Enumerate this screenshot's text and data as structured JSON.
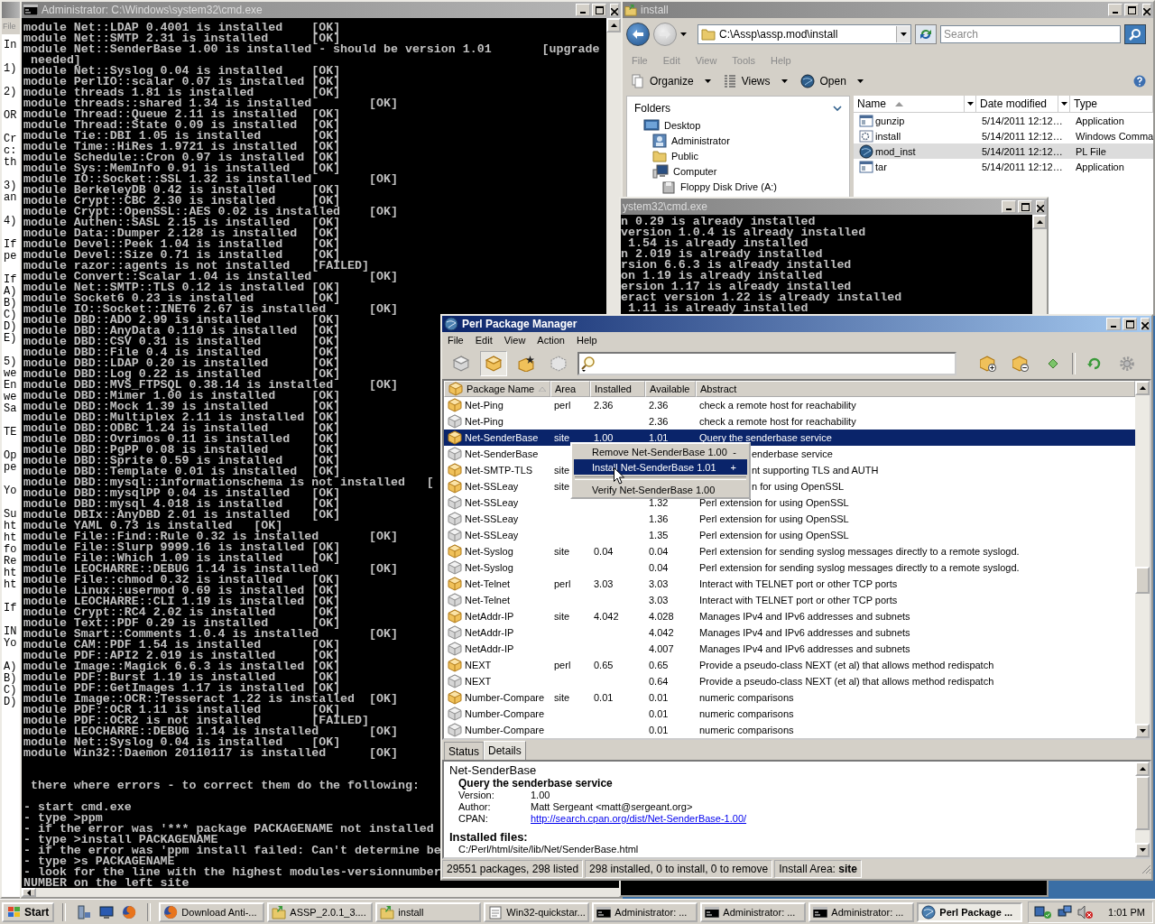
{
  "background_window": {
    "menu": "File",
    "blocks": [
      [
        "In"
      ],
      [
        "1)"
      ],
      [
        "2)"
      ],
      [
        "OR"
      ],
      [
        "Cr",
        "c:",
        "th"
      ],
      [
        "3)",
        "an"
      ],
      [
        "4)"
      ],
      [
        "If",
        "pe"
      ],
      [
        "If",
        "A)",
        "B)",
        "C)",
        "D)",
        "E)"
      ],
      [
        "5)",
        "we",
        "En",
        "we",
        "Sa"
      ],
      [
        "TE"
      ],
      [
        "Op",
        "pe"
      ],
      [
        "Yo"
      ],
      [
        "Su",
        "ht",
        "ht",
        "fo",
        "Re",
        "ht",
        "ht"
      ],
      [
        "If"
      ],
      [
        "IN",
        "Yo"
      ],
      [
        "A)",
        "B)",
        "C)",
        "D)"
      ]
    ]
  },
  "cmd_main": {
    "title": "Administrator: C:\\Windows\\system32\\cmd.exe",
    "blocks": [
      [
        "module Net::LDAP 0.4001 is installed\t[OK]",
        "module Net::SMTP 2.31 is installed\t[OK]",
        "module Net::SenderBase 1.00 is installed - should be version 1.01\t[upgrade",
        " needed]",
        "module Net::Syslog 0.04 is installed\t[OK]",
        "module PerlIO::scalar 0.07 is installed\t[OK]",
        "module threads 1.81 is installed\t[OK]",
        "module threads::shared 1.34 is installed\t[OK]",
        "module Thread::Queue 2.11 is installed\t[OK]",
        "module Thread::State 0.09 is installed\t[OK]",
        "module Tie::DBI 1.05 is installed\t[OK]",
        "module Time::HiRes 1.9721 is installed\t[OK]",
        "module Schedule::Cron 0.97 is installed\t[OK]",
        "module Sys::MemInfo 0.91 is installed\t[OK]",
        "module IO::Socket::SSL 1.32 is installed\t[OK]",
        "module BerkeleyDB 0.42 is installed\t[OK]",
        "module Crypt::CBC 2.30 is installed\t[OK]",
        "module Crypt::OpenSSL::AES 0.02 is installed\t[OK]",
        "module Authen::SASL 2.15 is installed\t[OK]",
        "module Data::Dumper 2.128 is installed\t[OK]",
        "module Devel::Peek 1.04 is installed\t[OK]",
        "module Devel::Size 0.71 is installed\t[OK]",
        "module razor::agents is not installed\t[FAILED]",
        "module Convert::Scalar 1.04 is installed\t[OK]",
        "module Net::SMTP::TLS 0.12 is installed\t[OK]",
        "module Socket6 0.23 is installed\t[OK]",
        "module IO::Socket::INET6 2.67 is installed\t[OK]",
        "module DBD::ADO 2.99 is installed\t[OK]",
        "module DBD::AnyData 0.110 is installed\t[OK]",
        "module DBD::CSV 0.31 is installed\t[OK]",
        "module DBD::File 0.4 is installed\t[OK]",
        "module DBD::LDAP 0.20 is installed\t[OK]",
        "module DBD::Log 0.22 is installed\t[OK]",
        "module DBD::MVS_FTPSQL 0.38.14 is installed\t[OK]",
        "module DBD::Mimer 1.00 is installed\t[OK]",
        "module DBD::Mock 1.39 is installed\t[OK]",
        "module DBD::Multiplex 2.11 is installed\t[OK]",
        "module DBD::ODBC 1.24 is installed\t[OK]",
        "module DBD::Ovrimos 0.11 is installed\t[OK]",
        "module DBD::PgPP 0.08 is installed\t[OK]",
        "module DBD::Sprite 0.59 is installed\t[OK]",
        "module DBD::Template 0.01 is installed\t[OK]",
        "module DBD::mysql::informationschema is not installed\t[",
        "module DBD::mysqlPP 0.04 is installed\t[OK]",
        "module DBD::mysql 4.018 is installed\t[OK]",
        "module DBIx::AnyDBD 2.01 is installed\t[OK]",
        "module YAML 0.73 is installed\t[OK]",
        "module File::Find::Rule 0.32 is installed\t[OK]",
        "module File::Slurp 9999.16 is installed\t[OK]",
        "module File::Which 1.09 is installed\t[OK]",
        "module LEOCHARRE::DEBUG 1.14 is installed\t[OK]",
        "module File::chmod 0.32 is installed\t[OK]",
        "module Linux::usermod 0.69 is installed\t[OK]",
        "module LEOCHARRE::CLI 1.19 is installed\t[OK]",
        "module Crypt::RC4 2.02 is installed\t[OK]",
        "module Text::PDF 0.29 is installed\t[OK]",
        "module Smart::Comments 1.0.4 is installed\t[OK]",
        "module CAM::PDF 1.54 is installed\t[OK]",
        "module PDF::API2 2.019 is installed\t[OK]",
        "module Image::Magick 6.6.3 is installed\t[OK]",
        "module PDF::Burst 1.19 is installed\t[OK]",
        "module PDF::GetImages 1.17 is installed\t[OK]",
        "module Image::OCR::Tesseract 1.22 is installed\t[OK]",
        "module PDF::OCR 1.11 is installed\t[OK]",
        "module PDF::OCR2 is not installed\t[FAILED]",
        "module LEOCHARRE::DEBUG 1.14 is installed\t[OK]",
        "module Net::Syslog 0.04 is installed\t[OK]",
        "module Win32::Daemon 20110117 is installed\t[OK]"
      ],
      [
        " there where errors - to correct them do the following:"
      ],
      [
        "- start cmd.exe",
        "- type >ppm",
        "- if the error was '*** package PACKAGENAME not installed",
        "- type >install PACKAGENAME",
        "- if the error was 'ppm install failed: Can't determine be",
        "- type >s PACKAGENAME",
        "- look for the line with the highest modules-versionnumber",
        "NUMBER on the left site"
      ]
    ]
  },
  "explorer": {
    "title": "install",
    "address": "C:\\Assp\\assp.mod\\install",
    "search": {
      "placeholder": "Search"
    },
    "menu": [
      "File",
      "Edit",
      "View",
      "Tools",
      "Help"
    ],
    "toolbar": [
      {
        "label": "Organize",
        "kind": "organize"
      },
      {
        "label": "Views",
        "kind": "views"
      },
      {
        "label": "Open",
        "kind": "open"
      }
    ],
    "folders": {
      "title": "Folders",
      "tree": [
        {
          "label": "Desktop",
          "kind": "desktop",
          "children": [
            {
              "label": "Administrator",
              "kind": "user"
            },
            {
              "label": "Public",
              "kind": "folder"
            },
            {
              "label": "Computer",
              "kind": "computer",
              "children": [
                {
                  "label": "Floppy Disk Drive (A:)",
                  "kind": "drive"
                }
              ]
            }
          ]
        }
      ]
    },
    "columns": [
      {
        "label": "Name",
        "sorted": true
      },
      {
        "label": "Date modified",
        "sorted": false
      },
      {
        "label": "Type",
        "sorted": false
      }
    ],
    "files": [
      {
        "name": "gunzip",
        "date": "5/14/2011 12:12…",
        "type": "Application",
        "kind": "app",
        "selected": false
      },
      {
        "name": "install",
        "date": "5/14/2011 12:12…",
        "type": "Windows Comma",
        "kind": "command",
        "selected": false
      },
      {
        "name": "mod_inst",
        "date": "5/14/2011 12:12…",
        "type": "PL File",
        "kind": "script",
        "selected": true
      },
      {
        "name": "tar",
        "date": "5/14/2011 12:12…",
        "type": "Application",
        "kind": "app",
        "selected": false
      }
    ]
  },
  "cmd2": {
    "title": "ystem32\\cmd.exe",
    "lines": [
      "n 0.29 is already installed",
      "version 1.0.4 is already installed",
      " 1.54 is already installed",
      "n 2.019 is already installed",
      "rsion 6.6.3 is already installed",
      "on 1.19 is already installed",
      "ersion 1.17 is already installed",
      "eract version 1.22 is already installed",
      " 1.11 is already installed"
    ]
  },
  "ppm": {
    "title": "Perl Package Manager",
    "menu": [
      "File",
      "Edit",
      "View",
      "Action",
      "Help"
    ],
    "toolbar_left": [
      {
        "kind": "all",
        "selected": false
      },
      {
        "kind": "installed",
        "selected": true
      },
      {
        "kind": "upgradable",
        "selected": false
      },
      {
        "kind": "modified",
        "selected": false
      }
    ],
    "toolbar_right": [
      {
        "kind": "install"
      },
      {
        "kind": "remove"
      },
      {
        "kind": "run"
      },
      {
        "kind": "sync"
      },
      {
        "kind": "preferences"
      }
    ],
    "columns": [
      {
        "label": "Package Name",
        "sorted": true
      },
      {
        "label": "Area",
        "sorted": false
      },
      {
        "label": "Installed",
        "sorted": false
      },
      {
        "label": "Available",
        "sorted": false
      },
      {
        "label": "Abstract",
        "sorted": false
      }
    ],
    "rows": [
      {
        "name": "Net-Ping",
        "area": "perl",
        "installed": "2.36",
        "available": "2.36",
        "abstract": "check a remote host for reachability",
        "kind": "installed",
        "selected": false
      },
      {
        "name": "Net-Ping",
        "available": "2.36",
        "abstract": "check a remote host for reachability",
        "kind": "available",
        "selected": false
      },
      {
        "name": "Net-SenderBase",
        "area": "site",
        "installed": "1.00",
        "available": "1.01",
        "abstract": "Query the senderbase service",
        "kind": "installed",
        "selected": true
      },
      {
        "name": "Net-SenderBase",
        "abstract": "enderbase service",
        "kind": "available",
        "selected": false
      },
      {
        "name": "Net-SMTP-TLS",
        "area": "site",
        "abstract": "nt supporting TLS and AUTH",
        "kind": "installed",
        "selected": false
      },
      {
        "name": "Net-SSLeay",
        "area": "site",
        "abstract": "n for using OpenSSL",
        "kind": "installed",
        "selected": false
      },
      {
        "name": "Net-SSLeay",
        "available": "1.32",
        "abstract": "Perl extension for using OpenSSL",
        "kind": "available",
        "selected": false
      },
      {
        "name": "Net-SSLeay",
        "available": "1.36",
        "abstract": "Perl extension for using OpenSSL",
        "kind": "available",
        "selected": false
      },
      {
        "name": "Net-SSLeay",
        "available": "1.35",
        "abstract": "Perl extension for using OpenSSL",
        "kind": "available",
        "selected": false
      },
      {
        "name": "Net-Syslog",
        "area": "site",
        "installed": "0.04",
        "available": "0.04",
        "abstract": "Perl extension for sending syslog messages directly to a remote syslogd.",
        "kind": "installed",
        "selected": false
      },
      {
        "name": "Net-Syslog",
        "available": "0.04",
        "abstract": "Perl extension for sending syslog messages directly to a remote syslogd.",
        "kind": "available",
        "selected": false
      },
      {
        "name": "Net-Telnet",
        "area": "perl",
        "installed": "3.03",
        "available": "3.03",
        "abstract": "Interact with TELNET port or other TCP ports",
        "kind": "installed",
        "selected": false
      },
      {
        "name": "Net-Telnet",
        "available": "3.03",
        "abstract": "Interact with TELNET port or other TCP ports",
        "kind": "available",
        "selected": false
      },
      {
        "name": "NetAddr-IP",
        "area": "site",
        "installed": "4.042",
        "available": "4.028",
        "abstract": "Manages IPv4 and IPv6 addresses and subnets",
        "kind": "installed",
        "selected": false
      },
      {
        "name": "NetAddr-IP",
        "available": "4.042",
        "abstract": "Manages IPv4 and IPv6 addresses and subnets",
        "kind": "available",
        "selected": false
      },
      {
        "name": "NetAddr-IP",
        "available": "4.007",
        "abstract": "Manages IPv4 and IPv6 addresses and subnets",
        "kind": "available",
        "selected": false
      },
      {
        "name": "NEXT",
        "area": "perl",
        "installed": "0.65",
        "available": "0.65",
        "abstract": "Provide a pseudo-class NEXT (et al) that allows method redispatch",
        "kind": "installed",
        "selected": false
      },
      {
        "name": "NEXT",
        "available": "0.64",
        "abstract": "Provide a pseudo-class NEXT (et al) that allows method redispatch",
        "kind": "available",
        "selected": false
      },
      {
        "name": "Number-Compare",
        "area": "site",
        "installed": "0.01",
        "available": "0.01",
        "abstract": "numeric comparisons",
        "kind": "installed",
        "selected": false
      },
      {
        "name": "Number-Compare",
        "available": "0.01",
        "abstract": "numeric comparisons",
        "kind": "available",
        "selected": false
      },
      {
        "name": "Number-Compare",
        "available": "0.01",
        "abstract": "numeric comparisons",
        "kind": "available",
        "selected": false
      }
    ],
    "context_menu": {
      "items": [
        {
          "kind": "command",
          "label": "Remove Net-SenderBase 1.00",
          "key": "-",
          "selected": false
        },
        {
          "kind": "command",
          "label": "Install Net-SenderBase 1.01",
          "key": "+",
          "selected": true
        },
        {
          "kind": "separator"
        },
        {
          "kind": "command",
          "label": "Verify Net-SenderBase 1.00",
          "selected": false
        }
      ]
    },
    "tabs": [
      {
        "label": "Status",
        "selected": false
      },
      {
        "label": "Details",
        "selected": true
      }
    ],
    "details": {
      "name": "Net-SenderBase",
      "abstract": "Query the senderbase service",
      "fields": [
        {
          "label": "Version:",
          "value": "1.00",
          "kind": "text"
        },
        {
          "label": "Author:",
          "value": "Matt Sergeant <matt@sergeant.org>",
          "kind": "text"
        },
        {
          "label": "CPAN:",
          "value": "http://search.cpan.org/dist/Net-SenderBase-1.00/",
          "kind": "link"
        }
      ],
      "files_heading": "Installed files:",
      "files": [
        "C:/Perl/html/site/lib/Net/SenderBase.html"
      ]
    },
    "status_bar": [
      "29551 packages, 298 listed",
      "298 installed, 0 to install, 0 to remove",
      "Install Area: **site**"
    ]
  },
  "taskbar": {
    "start": "Start",
    "quick_launch": [
      {
        "kind": "server"
      },
      {
        "kind": "desktop"
      },
      {
        "kind": "browser"
      }
    ],
    "tasks": [
      {
        "label": "Download Anti-...",
        "kind": "browser",
        "selected": false
      },
      {
        "label": "ASSP_2.0.1_3....",
        "kind": "archive",
        "selected": false
      },
      {
        "label": "install",
        "kind": "archive",
        "selected": false
      },
      {
        "label": "Win32-quickstar...",
        "kind": "document",
        "selected": false
      },
      {
        "label": "Administrator: ...",
        "kind": "console",
        "selected": false
      },
      {
        "label": "Administrator: ...",
        "kind": "console",
        "selected": false
      },
      {
        "label": "Administrator: ...",
        "kind": "console",
        "selected": false
      },
      {
        "label": "Perl Package ...",
        "kind": "ppm",
        "selected": true
      }
    ],
    "tray": [
      {
        "kind": "network-check"
      },
      {
        "kind": "network"
      },
      {
        "kind": "volume-muted"
      }
    ],
    "clock": "1:01 PM"
  }
}
